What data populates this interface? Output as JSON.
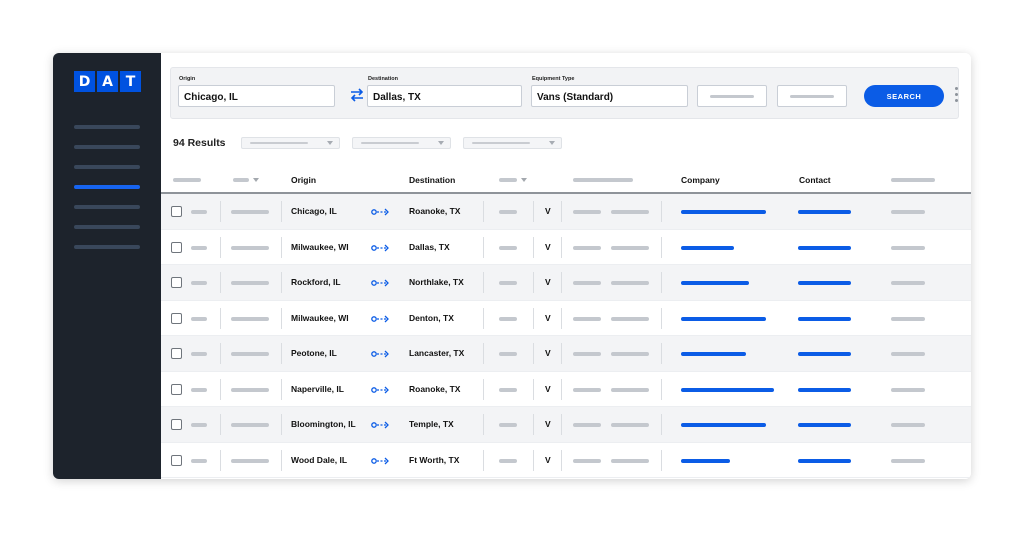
{
  "brand": {
    "letters": [
      "D",
      "A",
      "T"
    ],
    "color": "#0052e0"
  },
  "search": {
    "origin_label": "Origin",
    "origin_value": "Chicago, IL",
    "destination_label": "Destination",
    "destination_value": "Dallas, TX",
    "equipment_label": "Equipment Type",
    "equipment_value": "Vans (Standard)",
    "button_label": "SEARCH"
  },
  "results_label": "94 Results",
  "table": {
    "columns": {
      "origin": "Origin",
      "destination": "Destination",
      "company": "Company",
      "contact": "Contact"
    },
    "rows": [
      {
        "origin": "Chicago, IL",
        "destination": "Roanoke, TX",
        "equipment": "V"
      },
      {
        "origin": "Milwaukee, WI",
        "destination": "Dallas, TX",
        "equipment": "V"
      },
      {
        "origin": "Rockford, IL",
        "destination": "Northlake, TX",
        "equipment": "V"
      },
      {
        "origin": "Milwaukee, WI",
        "destination": "Denton, TX",
        "equipment": "V"
      },
      {
        "origin": "Peotone, IL",
        "destination": "Lancaster, TX",
        "equipment": "V"
      },
      {
        "origin": "Naperville, IL",
        "destination": "Roanoke, TX",
        "equipment": "V"
      },
      {
        "origin": "Bloomington, IL",
        "destination": "Temple, TX",
        "equipment": "V"
      },
      {
        "origin": "Wood Dale, IL",
        "destination": "Ft Worth, TX",
        "equipment": "V"
      }
    ]
  },
  "colors": {
    "sidebar": "#1d232c",
    "accent": "#0b5ce6"
  }
}
